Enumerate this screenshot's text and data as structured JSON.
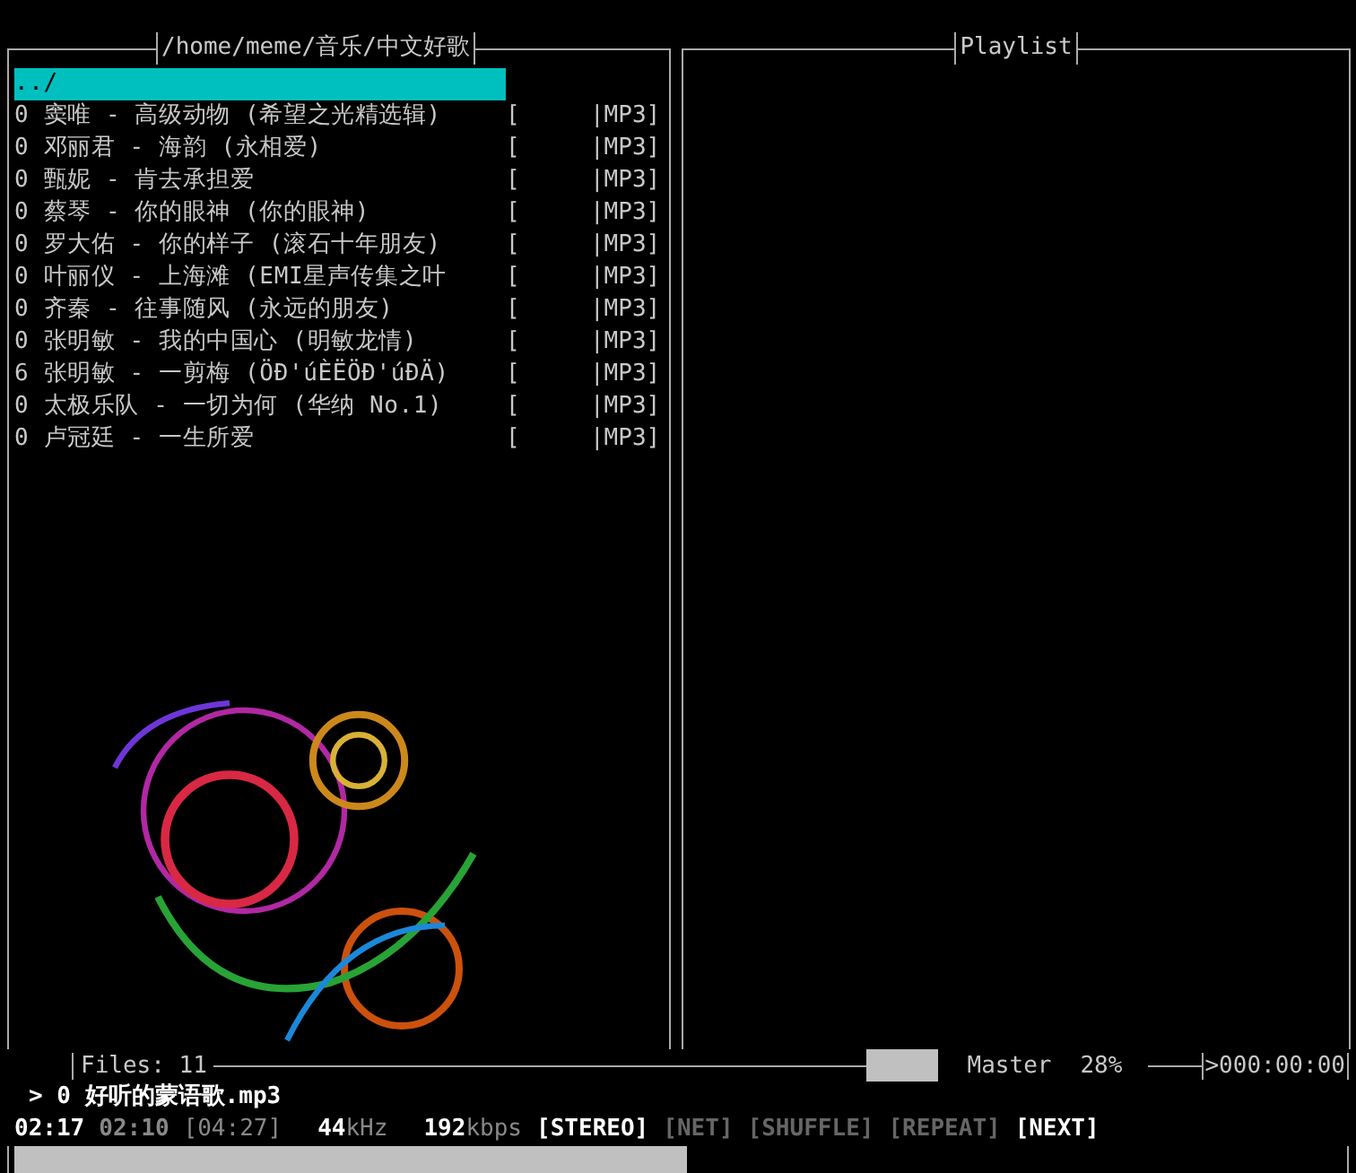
{
  "file_panel": {
    "title": "/home/meme/音乐/中文好歌",
    "rows": [
      {
        "name": "../",
        "info": "",
        "selected": true
      },
      {
        "name": "0 窦唯 - 高级动物 (希望之光精选辑)",
        "info": "[     |MP3]",
        "selected": false
      },
      {
        "name": "0 邓丽君 - 海韵 (永相爱)",
        "info": "[     |MP3]",
        "selected": false
      },
      {
        "name": "0 甄妮 - 肯去承担爱",
        "info": "[     |MP3]",
        "selected": false
      },
      {
        "name": "0 蔡琴 - 你的眼神 (你的眼神)",
        "info": "[     |MP3]",
        "selected": false
      },
      {
        "name": "0 罗大佑 - 你的样子 (滚石十年朋友)",
        "info": "[     |MP3]",
        "selected": false
      },
      {
        "name": "0 叶丽仪 - 上海滩 (EMI星声传集之叶",
        "info": "[     |MP3]",
        "selected": false
      },
      {
        "name": "0 齐秦 - 往事随风 (永远的朋友)",
        "info": "[     |MP3]",
        "selected": false
      },
      {
        "name": "0 张明敏 - 我的中国心 (明敏龙情)",
        "info": "[     |MP3]",
        "selected": false
      },
      {
        "name": "6 张明敏 - 一剪梅 (ÖÐ'úÈËÖÐ'úÐÄ)",
        "info": "[     |MP3]",
        "selected": false
      },
      {
        "name": "0 太极乐队 - 一切为何 (华纳 No.1)",
        "info": "[     |MP3]",
        "selected": false
      },
      {
        "name": "0 卢冠廷 - 一生所爱",
        "info": "[     |MP3]",
        "selected": false
      }
    ]
  },
  "playlist_panel": {
    "title": "Playlist"
  },
  "status": {
    "files": "Files: 11",
    "mixer": {
      "level": 0.28,
      "name": "Master",
      "percent": "28%"
    },
    "counter": ">000:00:00"
  },
  "now_playing": "> 0 好听的蒙语歌.mp3",
  "playback": {
    "elapsed": "02:17",
    "remaining": "02:10",
    "total": "[04:27]",
    "rate": "44",
    "rate_unit": "kHz",
    "bitrate": "192",
    "bitrate_unit": "kbps",
    "flags": [
      {
        "label": "[STEREO]",
        "on": true
      },
      {
        "label": "[NET]",
        "on": false
      },
      {
        "label": "[SHUFFLE]",
        "on": false
      },
      {
        "label": "[REPEAT]",
        "on": false
      },
      {
        "label": "[NEXT]",
        "on": true
      }
    ]
  },
  "progress": {
    "level": 0.51
  }
}
